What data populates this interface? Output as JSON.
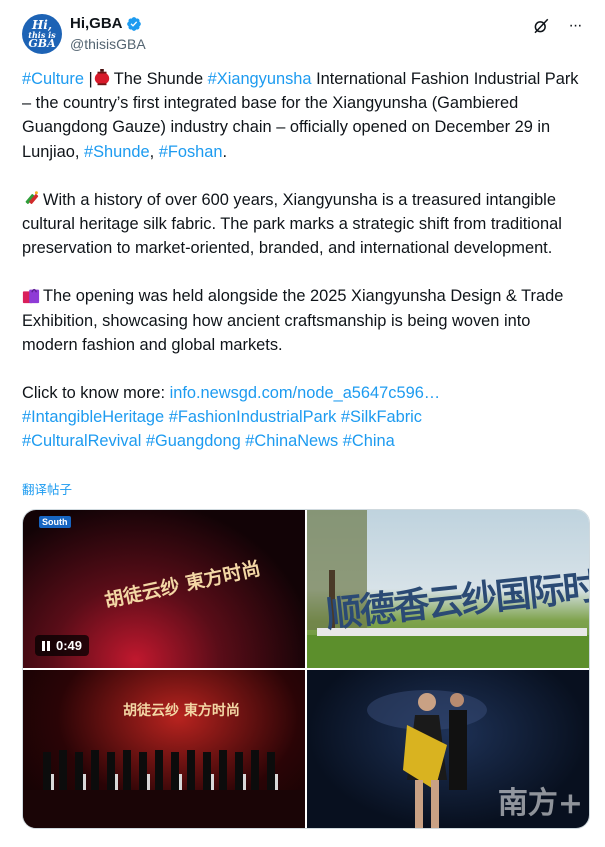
{
  "header": {
    "avatar_lines": [
      "Hi,",
      "this is",
      "GBA"
    ],
    "display_name": "Hi,GBA",
    "handle": "@thisisGBA",
    "more_label": "···"
  },
  "post": {
    "p1": {
      "tag_culture": "#Culture",
      "sep": " |",
      "t1": "The Shunde ",
      "tag_xiang": "#Xiangyunsha",
      "t2": " International Fashion Industrial Park – the country’s first integrated base for the Xiangyunsha (Gambiered Guangdong Gauze) industry chain – officially opened on December 29 in Lunjiao, ",
      "tag_shunde": "#Shunde",
      "t3": ", ",
      "tag_foshan": "#Foshan",
      "t4": "."
    },
    "p2": "With a history of over 600 years, Xiangyunsha is a treasured intangible cultural heritage silk fabric. The park marks a strategic shift from traditional preservation to market-oriented, branded, and international development.",
    "p3": "The opening was held alongside the 2025 Xiangyunsha Design & Trade Exhibition, showcasing how ancient craftsmanship is being woven into modern fashion and global markets.",
    "p4": {
      "lead": "Click to know more: ",
      "link": "info.newsgd.com/node_a5647c596…",
      "hashtags": [
        "#IntangibleHeritage",
        "#FashionIndustrialPark",
        "#SilkFabric",
        "#CulturalRevival",
        "#Guangdong",
        "#ChinaNews",
        "#China"
      ]
    },
    "translate": "翻译帖子"
  },
  "media": {
    "video_time": "0:49",
    "video_source_logo": "South",
    "stage_title": "胡徒云纱 東方时尚",
    "sign_text": "顺德香云纱国际时尚",
    "stage_title_2": "胡徒云纱 東方时尚",
    "watermark": "南方+"
  },
  "colors": {
    "link": "#1d9bf0",
    "text": "#0f1419",
    "secondary": "#536471",
    "verified": "#1d9bf0"
  }
}
